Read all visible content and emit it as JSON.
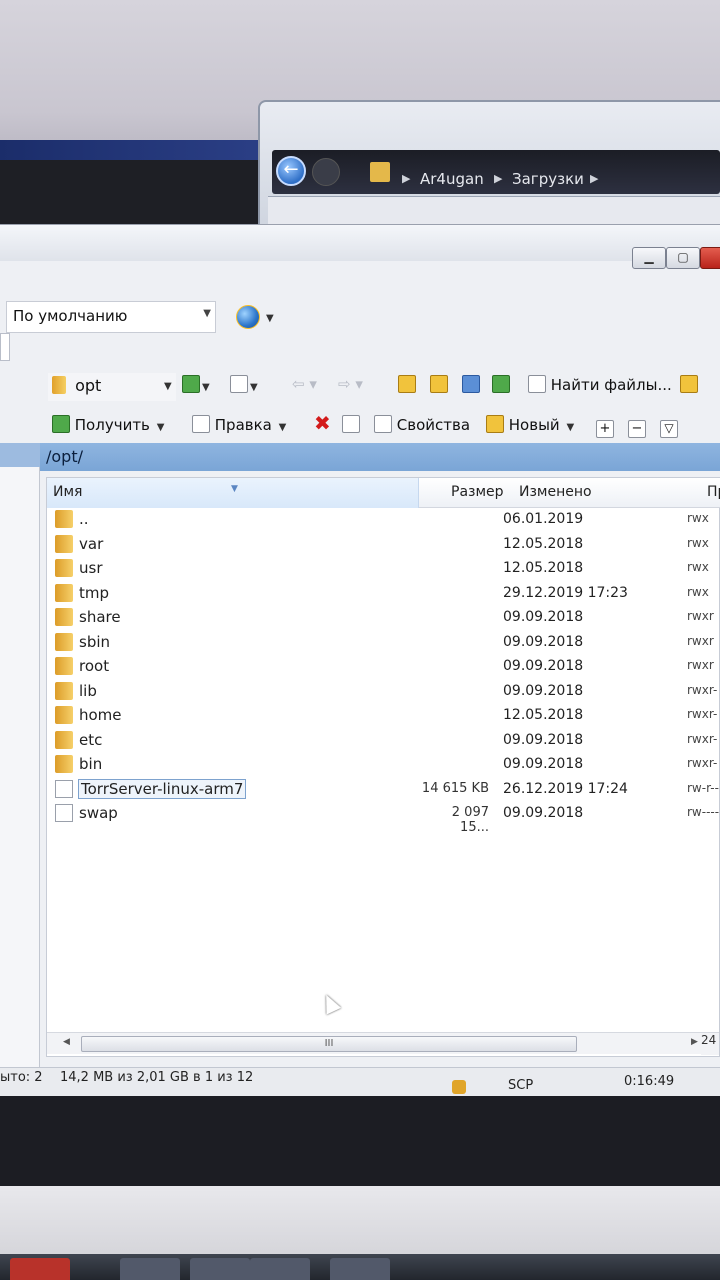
{
  "background_window": {
    "breadcrumb": [
      "Ar4ugan",
      "Загрузки"
    ]
  },
  "toolbar": {
    "session_profile": "По умолчанию",
    "current_dir_combo": "opt",
    "find_files": "Найти файлы...",
    "download": "Получить",
    "edit": "Правка",
    "properties": "Свойства",
    "new": "Новый",
    "plus": "+",
    "minus": "−",
    "filter": "▽"
  },
  "path": "/opt/",
  "columns": {
    "name": "Имя",
    "size": "Размер",
    "modified": "Изменено",
    "rights": "Пр"
  },
  "files": [
    {
      "name": "..",
      "size": "",
      "modified": "06.01.2019",
      "rights": "rwx",
      "type": "up"
    },
    {
      "name": "var",
      "size": "",
      "modified": "12.05.2018",
      "rights": "rwx",
      "type": "dir"
    },
    {
      "name": "usr",
      "size": "",
      "modified": "12.05.2018",
      "rights": "rwx",
      "type": "dir"
    },
    {
      "name": "tmp",
      "size": "",
      "modified": "29.12.2019 17:23",
      "rights": "rwx",
      "type": "dir"
    },
    {
      "name": "share",
      "size": "",
      "modified": "09.09.2018",
      "rights": "rwxr",
      "type": "dir"
    },
    {
      "name": "sbin",
      "size": "",
      "modified": "09.09.2018",
      "rights": "rwxr",
      "type": "dir"
    },
    {
      "name": "root",
      "size": "",
      "modified": "09.09.2018",
      "rights": "rwxr",
      "type": "dir"
    },
    {
      "name": "lib",
      "size": "",
      "modified": "09.09.2018",
      "rights": "rwxr-",
      "type": "dir"
    },
    {
      "name": "home",
      "size": "",
      "modified": "12.05.2018",
      "rights": "rwxr-",
      "type": "dir"
    },
    {
      "name": "etc",
      "size": "",
      "modified": "09.09.2018",
      "rights": "rwxr-",
      "type": "dir"
    },
    {
      "name": "bin",
      "size": "",
      "modified": "09.09.2018",
      "rights": "rwxr-",
      "type": "dir"
    },
    {
      "name": "TorrServer-linux-arm7",
      "size": "14 615 KB",
      "modified": "26.12.2019 17:24",
      "rights": "rw-r--",
      "type": "file",
      "selected": true
    },
    {
      "name": "swap",
      "size": "2 097 15...",
      "modified": "09.09.2018",
      "rights": "rw----",
      "type": "file"
    }
  ],
  "scroll": {
    "right_edge": "24",
    "thumb_grip": "III"
  },
  "status": {
    "selected": "ыто: 2",
    "summary": "14,2 MB из 2,01 GB в 1 из 12",
    "protocol": "SCP",
    "time": "0:16:49"
  }
}
